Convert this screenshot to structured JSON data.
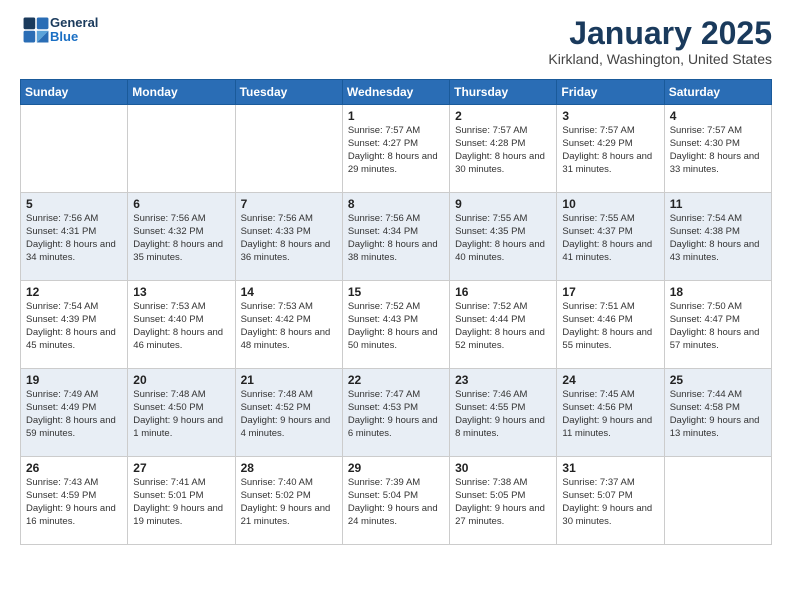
{
  "header": {
    "logo_line1": "General",
    "logo_line2": "Blue",
    "month": "January 2025",
    "location": "Kirkland, Washington, United States"
  },
  "days_of_week": [
    "Sunday",
    "Monday",
    "Tuesday",
    "Wednesday",
    "Thursday",
    "Friday",
    "Saturday"
  ],
  "weeks": [
    [
      {
        "day": "",
        "info": ""
      },
      {
        "day": "",
        "info": ""
      },
      {
        "day": "",
        "info": ""
      },
      {
        "day": "1",
        "info": "Sunrise: 7:57 AM\nSunset: 4:27 PM\nDaylight: 8 hours and 29 minutes."
      },
      {
        "day": "2",
        "info": "Sunrise: 7:57 AM\nSunset: 4:28 PM\nDaylight: 8 hours and 30 minutes."
      },
      {
        "day": "3",
        "info": "Sunrise: 7:57 AM\nSunset: 4:29 PM\nDaylight: 8 hours and 31 minutes."
      },
      {
        "day": "4",
        "info": "Sunrise: 7:57 AM\nSunset: 4:30 PM\nDaylight: 8 hours and 33 minutes."
      }
    ],
    [
      {
        "day": "5",
        "info": "Sunrise: 7:56 AM\nSunset: 4:31 PM\nDaylight: 8 hours and 34 minutes."
      },
      {
        "day": "6",
        "info": "Sunrise: 7:56 AM\nSunset: 4:32 PM\nDaylight: 8 hours and 35 minutes."
      },
      {
        "day": "7",
        "info": "Sunrise: 7:56 AM\nSunset: 4:33 PM\nDaylight: 8 hours and 36 minutes."
      },
      {
        "day": "8",
        "info": "Sunrise: 7:56 AM\nSunset: 4:34 PM\nDaylight: 8 hours and 38 minutes."
      },
      {
        "day": "9",
        "info": "Sunrise: 7:55 AM\nSunset: 4:35 PM\nDaylight: 8 hours and 40 minutes."
      },
      {
        "day": "10",
        "info": "Sunrise: 7:55 AM\nSunset: 4:37 PM\nDaylight: 8 hours and 41 minutes."
      },
      {
        "day": "11",
        "info": "Sunrise: 7:54 AM\nSunset: 4:38 PM\nDaylight: 8 hours and 43 minutes."
      }
    ],
    [
      {
        "day": "12",
        "info": "Sunrise: 7:54 AM\nSunset: 4:39 PM\nDaylight: 8 hours and 45 minutes."
      },
      {
        "day": "13",
        "info": "Sunrise: 7:53 AM\nSunset: 4:40 PM\nDaylight: 8 hours and 46 minutes."
      },
      {
        "day": "14",
        "info": "Sunrise: 7:53 AM\nSunset: 4:42 PM\nDaylight: 8 hours and 48 minutes."
      },
      {
        "day": "15",
        "info": "Sunrise: 7:52 AM\nSunset: 4:43 PM\nDaylight: 8 hours and 50 minutes."
      },
      {
        "day": "16",
        "info": "Sunrise: 7:52 AM\nSunset: 4:44 PM\nDaylight: 8 hours and 52 minutes."
      },
      {
        "day": "17",
        "info": "Sunrise: 7:51 AM\nSunset: 4:46 PM\nDaylight: 8 hours and 55 minutes."
      },
      {
        "day": "18",
        "info": "Sunrise: 7:50 AM\nSunset: 4:47 PM\nDaylight: 8 hours and 57 minutes."
      }
    ],
    [
      {
        "day": "19",
        "info": "Sunrise: 7:49 AM\nSunset: 4:49 PM\nDaylight: 8 hours and 59 minutes."
      },
      {
        "day": "20",
        "info": "Sunrise: 7:48 AM\nSunset: 4:50 PM\nDaylight: 9 hours and 1 minute."
      },
      {
        "day": "21",
        "info": "Sunrise: 7:48 AM\nSunset: 4:52 PM\nDaylight: 9 hours and 4 minutes."
      },
      {
        "day": "22",
        "info": "Sunrise: 7:47 AM\nSunset: 4:53 PM\nDaylight: 9 hours and 6 minutes."
      },
      {
        "day": "23",
        "info": "Sunrise: 7:46 AM\nSunset: 4:55 PM\nDaylight: 9 hours and 8 minutes."
      },
      {
        "day": "24",
        "info": "Sunrise: 7:45 AM\nSunset: 4:56 PM\nDaylight: 9 hours and 11 minutes."
      },
      {
        "day": "25",
        "info": "Sunrise: 7:44 AM\nSunset: 4:58 PM\nDaylight: 9 hours and 13 minutes."
      }
    ],
    [
      {
        "day": "26",
        "info": "Sunrise: 7:43 AM\nSunset: 4:59 PM\nDaylight: 9 hours and 16 minutes."
      },
      {
        "day": "27",
        "info": "Sunrise: 7:41 AM\nSunset: 5:01 PM\nDaylight: 9 hours and 19 minutes."
      },
      {
        "day": "28",
        "info": "Sunrise: 7:40 AM\nSunset: 5:02 PM\nDaylight: 9 hours and 21 minutes."
      },
      {
        "day": "29",
        "info": "Sunrise: 7:39 AM\nSunset: 5:04 PM\nDaylight: 9 hours and 24 minutes."
      },
      {
        "day": "30",
        "info": "Sunrise: 7:38 AM\nSunset: 5:05 PM\nDaylight: 9 hours and 27 minutes."
      },
      {
        "day": "31",
        "info": "Sunrise: 7:37 AM\nSunset: 5:07 PM\nDaylight: 9 hours and 30 minutes."
      },
      {
        "day": "",
        "info": ""
      }
    ]
  ]
}
